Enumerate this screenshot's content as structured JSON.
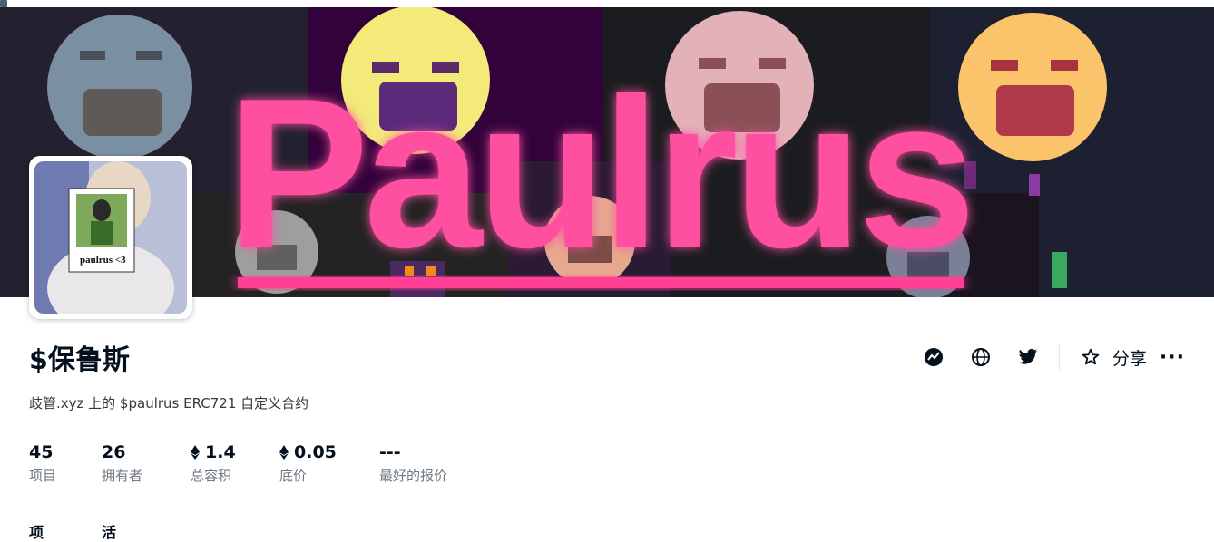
{
  "collection": {
    "name": "$保鲁斯",
    "description": "歧管.xyz 上的 $paulrus ERC721 自定义合约",
    "banner_text": "Paulrus",
    "avatar_caption": "paulrus <3"
  },
  "actions": {
    "share_label": "分享",
    "more_label": "···",
    "icons": [
      "activity-icon",
      "globe-icon",
      "twitter-icon",
      "star-icon",
      "more-icon"
    ]
  },
  "stats": [
    {
      "value": "45",
      "label": "项目",
      "eth": false
    },
    {
      "value": "26",
      "label": "拥有者",
      "eth": false
    },
    {
      "value": "1.4",
      "label": "总容积",
      "eth": true
    },
    {
      "value": "0.05",
      "label": "底价",
      "eth": true
    },
    {
      "value": "---",
      "label": "最好的报价",
      "eth": false
    }
  ],
  "tabs": [
    {
      "label": "项"
    },
    {
      "label": "活"
    }
  ],
  "colors": {
    "accent_pink": "#ff4fa0",
    "text_dark": "#04111d",
    "text_muted": "#707a83"
  }
}
